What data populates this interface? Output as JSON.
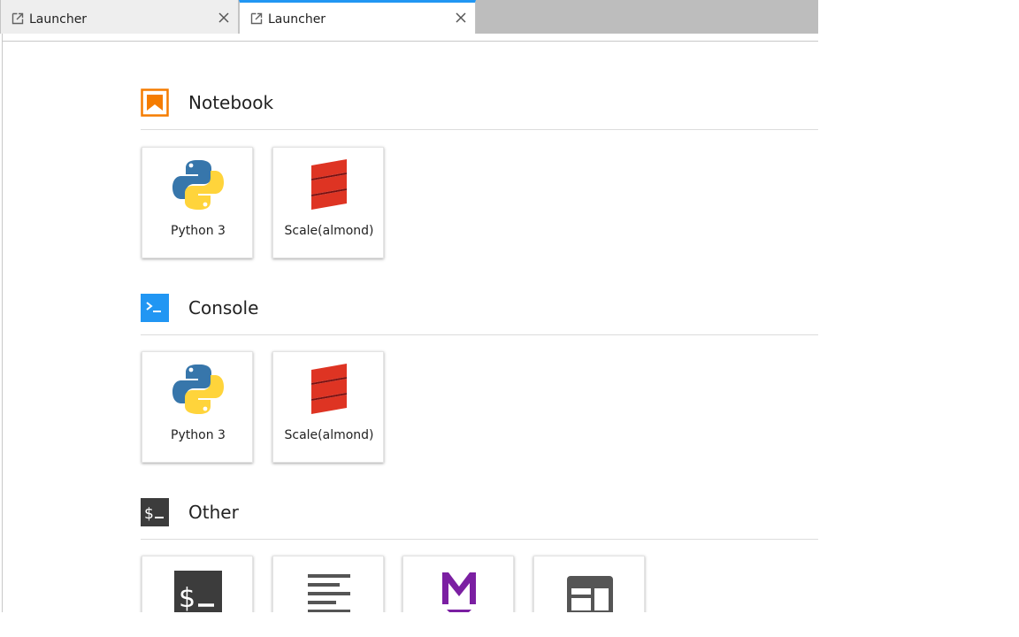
{
  "tabs": [
    {
      "label": "Launcher",
      "icon": "launch-icon",
      "active": false
    },
    {
      "label": "Launcher",
      "icon": "launch-icon",
      "active": true
    }
  ],
  "sections": [
    {
      "title": "Notebook",
      "icon": "notebook-icon",
      "cards": [
        {
          "label": "Python 3",
          "icon": "python-logo-icon"
        },
        {
          "label": "Scale(almond)",
          "icon": "scala-logo-icon"
        }
      ]
    },
    {
      "title": "Console",
      "icon": "console-icon",
      "cards": [
        {
          "label": "Python 3",
          "icon": "python-logo-icon"
        },
        {
          "label": "Scale(almond)",
          "icon": "scala-logo-icon"
        }
      ]
    },
    {
      "title": "Other",
      "icon": "terminal-icon",
      "cards": [
        {
          "label": "",
          "icon": "terminal-icon"
        },
        {
          "label": "",
          "icon": "text-file-icon"
        },
        {
          "label": "",
          "icon": "markdown-icon"
        },
        {
          "label": "",
          "icon": "contextual-help-icon"
        }
      ]
    }
  ],
  "colors": {
    "accent": "#2196f3",
    "notebook_orange": "#f57c00",
    "console_blue": "#2196f3",
    "terminal_dark": "#3c3c3c",
    "markdown_purple": "#7b1fa2",
    "scala_red": "#de3423",
    "python_blue": "#3776ab",
    "python_yellow": "#ffd43b"
  }
}
